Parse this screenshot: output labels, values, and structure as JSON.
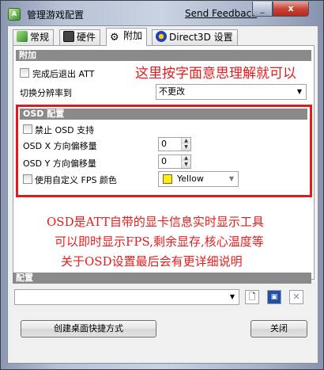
{
  "window": {
    "title": "管理游戏配置",
    "send_feedback": "Send Feedback",
    "minimize_glyph": "_",
    "close_glyph": "x",
    "app_icon": "att-app-icon"
  },
  "tabs": [
    {
      "label": "常规",
      "icon": "general-icon"
    },
    {
      "label": "硬件",
      "icon": "hardware-icon"
    },
    {
      "label": "附加",
      "icon": "gear-icon",
      "active": true
    },
    {
      "label": "Direct3D 设置",
      "icon": "directx-icon"
    }
  ],
  "extras": {
    "heading": "附加",
    "exit_att_label": "完成后退出 ATT",
    "resolution_label": "切换分辨率到",
    "resolution_value": "不更改"
  },
  "osd": {
    "heading": "OSD 配置",
    "disable_label": "禁止 OSD 支持",
    "x_offset_label": "OSD X 方向偏移量",
    "x_offset_value": "0",
    "y_offset_label": "OSD Y 方向偏移量",
    "y_offset_value": "0",
    "custom_color_label": "使用自定义 FPS 颜色",
    "color_value": "Yellow",
    "color_hex": "#ffee00"
  },
  "annotations": {
    "top_note": "这里按字面意思理解就可以",
    "osd_note_lines": [
      "OSD是ATT自带的显卡信息实时显示工具",
      "可以即时显示FPS,剩余显存,核心温度等",
      "关于OSD设置最后会有更详细说明"
    ],
    "color": "#e21d1d"
  },
  "config": {
    "heading": "配置",
    "profile_value": ""
  },
  "buttons": {
    "create_shortcut": "创建桌面快捷方式",
    "close": "关闭"
  }
}
